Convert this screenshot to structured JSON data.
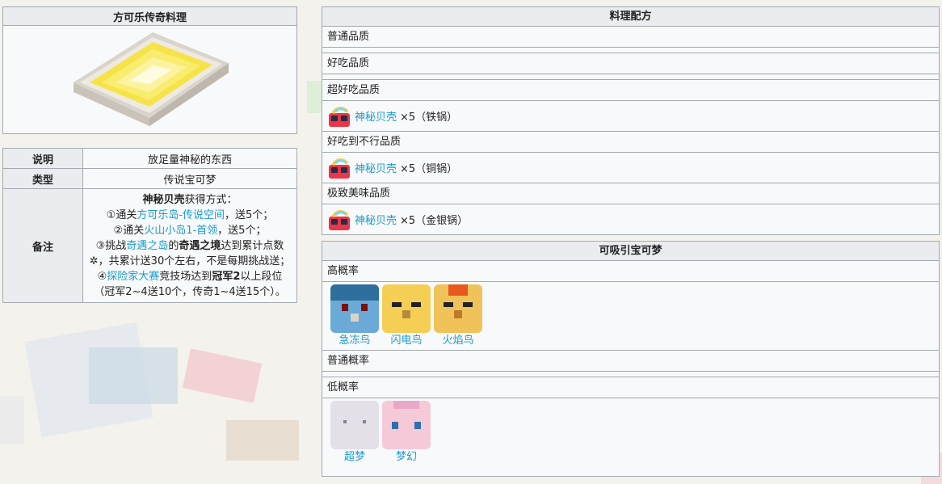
{
  "info": {
    "title": "方可乐传奇料理",
    "rows": {
      "description_label": "说明",
      "description_value": "放足量神秘的东西",
      "type_label": "类型",
      "type_value": "传说宝可梦",
      "remark_label": "备注"
    },
    "remark": {
      "heading_bold": "神秘贝壳",
      "heading_rest": "获得方式：",
      "l1_pre": "①通关",
      "l1_link": "方可乐岛-传说空间",
      "l1_post": "，送5个；",
      "l2_pre": "②通关",
      "l2_link": "火山小岛1-首领",
      "l2_post": "，送5个；",
      "l3_pre": "③挑战",
      "l3_link": "奇遇之岛",
      "l3_mid": "的",
      "l3_bold": "奇遇之境",
      "l3_post": "达到累计点数",
      "l3_icon": "✲",
      "l3_post2": "，共累计送30个左右，不是每期挑战送；",
      "l4_pre": "④",
      "l4_link": "探险家大赛",
      "l4_mid": "竞技场达到",
      "l4_bold": "冠军2",
      "l4_post": "以上段位（冠军2~4送10个，传奇1~4送15个）。"
    }
  },
  "recipe": {
    "title": "料理配方",
    "normal": "普通品质",
    "good": "好吃品质",
    "great": "超好吃品质",
    "great_item": "神秘贝壳",
    "great_amount": "×5（铁锅）",
    "very_good": "好吃到不行品质",
    "very_good_item": "神秘贝壳",
    "very_good_amount": "×5（铜锅）",
    "best": "极致美味品质",
    "best_item": "神秘贝壳",
    "best_amount": "×5（金银锅）",
    "icon": "mystery-shell-icon"
  },
  "attract": {
    "title": "可吸引宝可梦",
    "high_label": "高概率",
    "high": [
      {
        "name": "急冻鸟",
        "color": "#6aa9d8"
      },
      {
        "name": "闪电鸟",
        "color": "#f5cf55"
      },
      {
        "name": "火焰鸟",
        "color": "#f0c35a"
      }
    ],
    "normal_label": "普通概率",
    "low_label": "低概率",
    "low": [
      {
        "name": "超梦",
        "color": "#e4e0e8"
      },
      {
        "name": "梦幻",
        "color": "#f6c9d8"
      }
    ]
  }
}
